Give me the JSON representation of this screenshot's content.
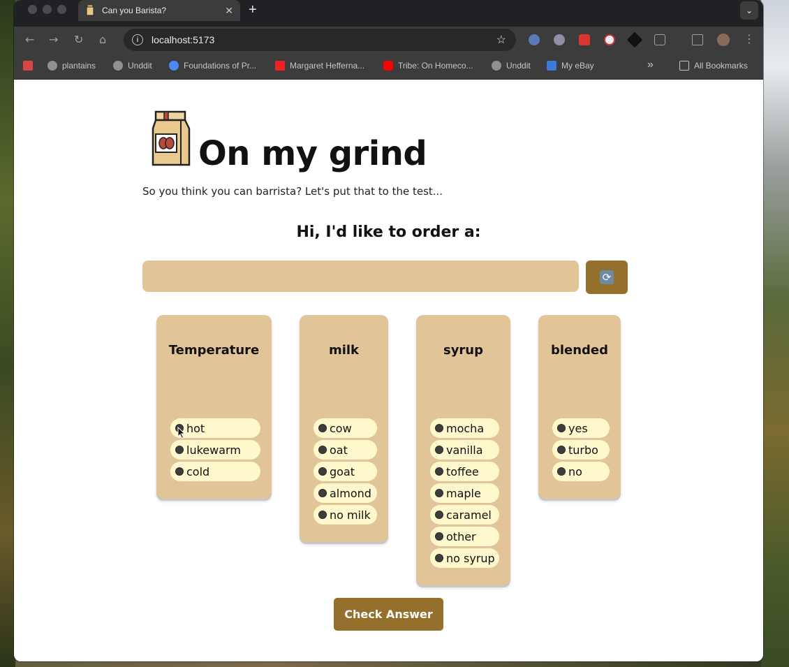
{
  "browser": {
    "tab_title": "Can you Barista?",
    "tab_close": "✕",
    "new_tab": "+",
    "url": "localhost:5173",
    "bookmarks": [
      "plantains",
      "Unddit",
      "Foundations of Pr...",
      "Margaret Hefferna...",
      "Tribe: On Homeco...",
      "Unddit",
      "My eBay"
    ],
    "overflow": "»",
    "all_bookmarks": "All Bookmarks"
  },
  "page": {
    "heading": "On my grind",
    "tagline": "So you think you can barrista? Let's put that to the test...",
    "order_prompt": "Hi, I'd like to order a:",
    "order_value": "",
    "check_button": "Check Answer"
  },
  "categories": [
    {
      "title": "Temperature",
      "options": [
        "hot",
        "lukewarm",
        "cold"
      ]
    },
    {
      "title": "milk",
      "options": [
        "cow",
        "oat",
        "goat",
        "almond",
        "no milk"
      ]
    },
    {
      "title": "syrup",
      "options": [
        "mocha",
        "vanilla",
        "toffee",
        "maple",
        "caramel",
        "other",
        "no syrup"
      ]
    },
    {
      "title": "blended",
      "options": [
        "yes",
        "turbo",
        "no"
      ]
    }
  ],
  "colors": {
    "card": "#e1c498",
    "option": "#fff8cc",
    "button": "#95702c"
  }
}
